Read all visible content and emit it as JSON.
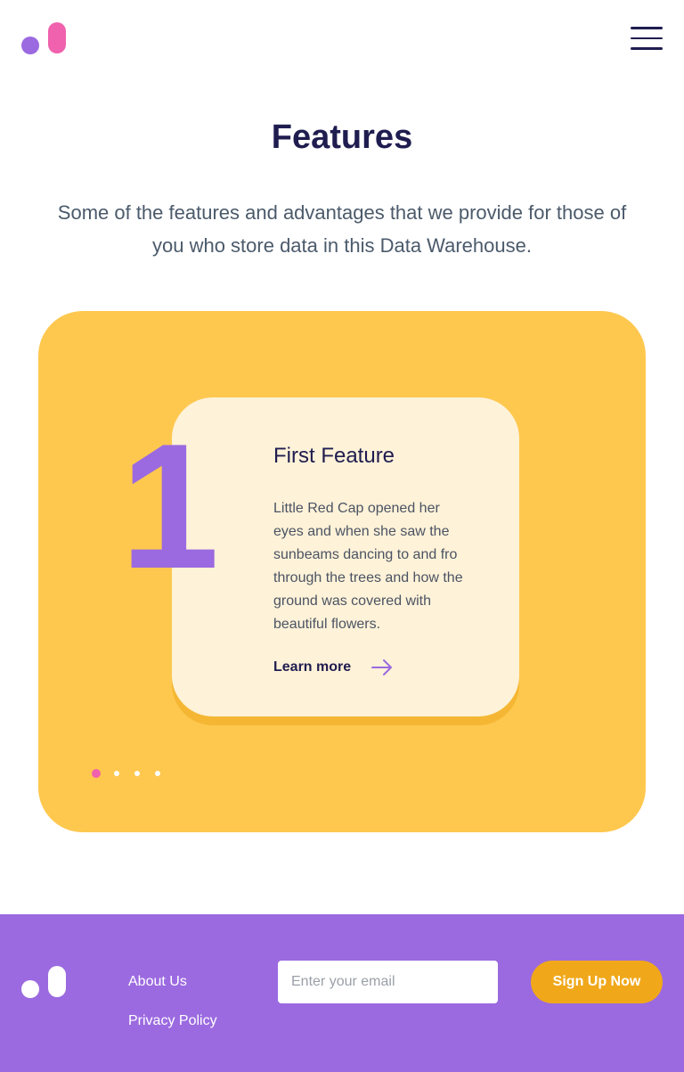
{
  "header": {
    "logo_icon": "brand-logo-icon",
    "menu_icon": "hamburger-menu-icon"
  },
  "features": {
    "title": "Features",
    "subtitle": "Some of the features and advantages that we provide for those of you who store data in this Data Warehouse."
  },
  "carousel": {
    "slide_number": "1",
    "card": {
      "title": "First Feature",
      "text": "Little Red Cap opened her eyes and when she saw the sunbeams dancing to and fro through the trees and how the ground was covered with beautiful flowers.",
      "link_label": "Learn more",
      "link_icon": "arrow-right-icon"
    },
    "slide_count": 4,
    "active_slide": 1
  },
  "footer": {
    "logo_icon": "brand-logo-icon",
    "links": [
      "About Us",
      "Privacy Policy"
    ],
    "email_placeholder": "Enter your email",
    "email_value": "",
    "signup_label": "Sign Up Now"
  },
  "colors": {
    "brand_purple": "#9b6ae0",
    "brand_pink": "#f062ad",
    "carousel_yellow": "#fec84f",
    "card_cream": "#fef2d8",
    "signup_orange": "#f0a81a",
    "heading_navy": "#1f1d4f"
  }
}
